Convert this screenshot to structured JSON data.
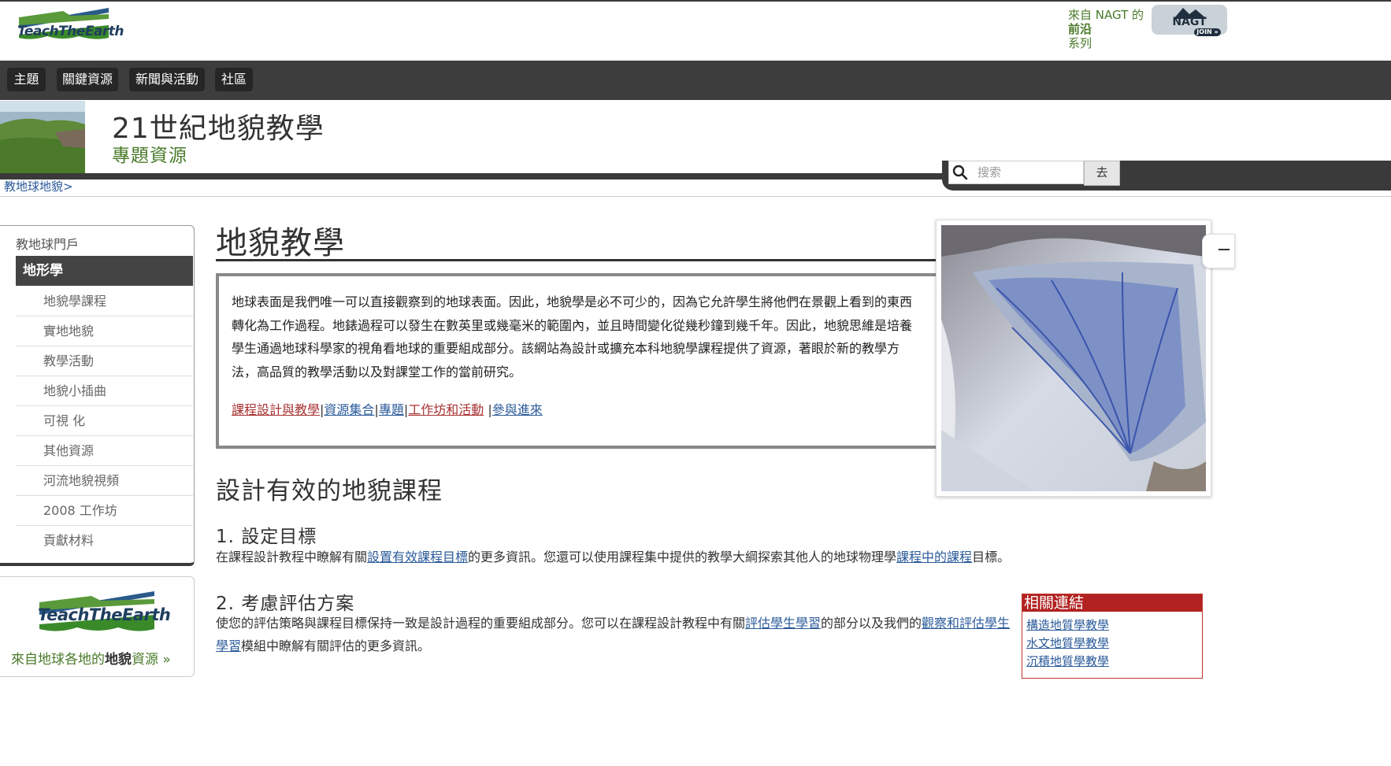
{
  "header": {
    "logo_text": "TeachTheEarth",
    "nagt_line1": "來自 NAGT 的",
    "nagt_line2": "前沿",
    "nagt_line3": "系列",
    "nagt_badge": "NAGT",
    "nagt_join": "JOIN »"
  },
  "nav": [
    "主題",
    "關鍵資源",
    "新聞與活動",
    "社區"
  ],
  "banner": {
    "title": "21世紀地貌教學",
    "subtitle": "專題資源"
  },
  "search": {
    "placeholder": "搜索",
    "button": "去"
  },
  "breadcrumb": "教地球地貌>",
  "sidebar": {
    "top": "教地球門戶",
    "active": "地形學",
    "items": [
      "地貌學課程",
      "實地地貌",
      "教學活動",
      "地貌小插曲",
      "可視 化",
      "其他資源",
      "河流地貌視頻",
      "2008 工作坊",
      "貢獻材料"
    ]
  },
  "promo": {
    "logo_text": "TeachTheEarth",
    "text_prefix": "來自地球各地的",
    "text_bold": "地貌",
    "text_suffix": "資源 »"
  },
  "main": {
    "title": "地貌教學",
    "intro": "地球表面是我們唯一可以直接觀察到的地球表面。因此，地貌學是必不可少的，因為它允許學生將他們在景觀上看到的東西轉化為工作過程。地錶過程可以發生在數英里或幾毫米的範圍內，並且時間變化從幾秒鐘到幾千年。因此，地貌思維是培養學生通過地球科學家的視角看地球的重要組成部分。該網站為設計或擴充本科地貌學課程提供了資源，著眼於新的教學方法，高品質的教學活動以及對課堂工作的當前研究。",
    "links": [
      "課程設計與教學",
      "資源集合",
      "專題",
      "工作坊和活動",
      "參與進來"
    ],
    "h2": "設計有效的地貌課程",
    "s1_title": "1. 設定目標",
    "s1_a": "在課程設計教程中瞭解有關",
    "s1_link1": "設置有效課程目標",
    "s1_b": "的更多資訊。您還可以使用課程集中提供的教學大綱探索其他人的地球物理學",
    "s1_link2": "課程中的課程",
    "s1_c": "目標。",
    "s2_title": "2. 考慮評估方案",
    "s2_a": "使您的評估策略與課程目標保持一致是設計過程的重要組成部分。您可以在課程設計教程中有關",
    "s2_link1": "評估學生學習",
    "s2_b": "的部分以及我們的",
    "s2_link2": "觀察和評估學生學習",
    "s2_c": "模組中瞭解有關評估的更多資訊。"
  },
  "related": {
    "title": "相關連結",
    "links": [
      "構造地質學教學",
      "水文地質學教學",
      "沉積地質學教學"
    ]
  }
}
